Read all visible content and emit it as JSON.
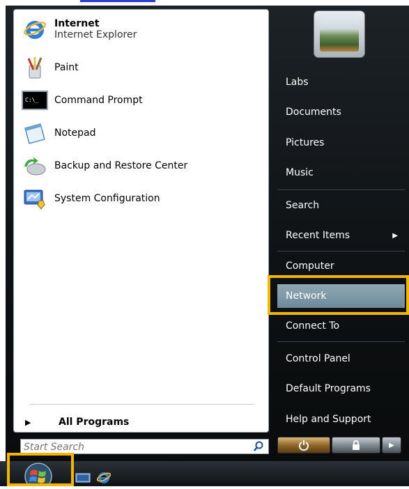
{
  "pinned": [
    {
      "name": "Internet",
      "subtitle": "Internet Explorer",
      "icon": "internet-explorer-icon"
    }
  ],
  "recent": [
    {
      "name": "Paint",
      "icon": "paint-icon"
    },
    {
      "name": "Command Prompt",
      "icon": "command-prompt-icon"
    },
    {
      "name": "Notepad",
      "icon": "notepad-icon"
    },
    {
      "name": "Backup and Restore Center",
      "icon": "backup-restore-icon"
    },
    {
      "name": "System Configuration",
      "icon": "system-configuration-icon"
    }
  ],
  "all_programs_label": "All Programs",
  "search": {
    "placeholder": "Start Search"
  },
  "right_items": [
    {
      "label": "Labs"
    },
    {
      "label": "Documents"
    },
    {
      "label": "Pictures"
    },
    {
      "label": "Music"
    },
    {
      "label": "Search"
    },
    {
      "label": "Recent Items"
    },
    {
      "label": "Computer"
    },
    {
      "label": "Network"
    },
    {
      "label": "Connect To"
    },
    {
      "label": "Control Panel"
    },
    {
      "label": "Default Programs"
    },
    {
      "label": "Help and Support"
    }
  ],
  "selected_item": "Network",
  "colors": {
    "highlight": "#f2b705",
    "selection": "#7d97a6",
    "menu_dark": "#101315"
  }
}
